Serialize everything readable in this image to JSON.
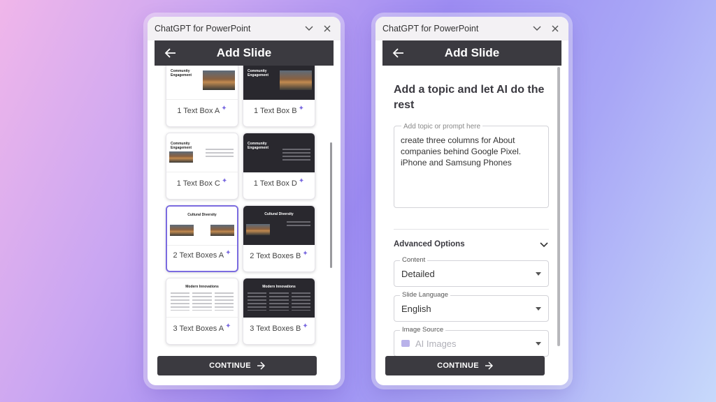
{
  "left_panel": {
    "window_title": "ChatGPT for PowerPoint",
    "header_title": "Add Slide",
    "cards": [
      {
        "label": "1 Text Box A",
        "thumb_title": "Community Engagement",
        "theme": "light",
        "layout": "pic-right"
      },
      {
        "label": "1 Text Box B",
        "thumb_title": "Community Engagement",
        "theme": "dark",
        "layout": "pic-right"
      },
      {
        "label": "1 Text Box C",
        "thumb_title": "Community Engagement",
        "theme": "light",
        "layout": "pic-left"
      },
      {
        "label": "1 Text Box D",
        "thumb_title": "Community Engagement",
        "theme": "dark",
        "layout": "text"
      },
      {
        "label": "2 Text Boxes A",
        "thumb_title": "Cultural Diversity",
        "theme": "light",
        "layout": "two-pic"
      },
      {
        "label": "2 Text Boxes B",
        "thumb_title": "Cultural Diversity",
        "theme": "dark",
        "layout": "two-pic"
      },
      {
        "label": "3 Text Boxes A",
        "thumb_title": "Modern Innovations",
        "theme": "light",
        "layout": "cols"
      },
      {
        "label": "3 Text Boxes B",
        "thumb_title": "Modern Innovations",
        "theme": "dark",
        "layout": "cols"
      }
    ],
    "selected_card": "2 Text Boxes A",
    "continue_label": "CONTINUE"
  },
  "right_panel": {
    "window_title": "ChatGPT for PowerPoint",
    "header_title": "Add Slide",
    "heading": "Add a topic and let AI do the rest",
    "prompt_placeholder": "Add topic or prompt here",
    "prompt_value": "create three columns for About companies behind Google Pixel. iPhone and Samsung Phones",
    "advanced_label": "Advanced Options",
    "content_label": "Content",
    "content_value": "Detailed",
    "language_label": "Slide Language",
    "language_value": "English",
    "image_source_label": "Image Source",
    "image_source_value": "AI Images",
    "continue_label": "CONTINUE"
  },
  "colors": {
    "header_bg": "#3b3a40",
    "accent": "#7b6be0"
  }
}
